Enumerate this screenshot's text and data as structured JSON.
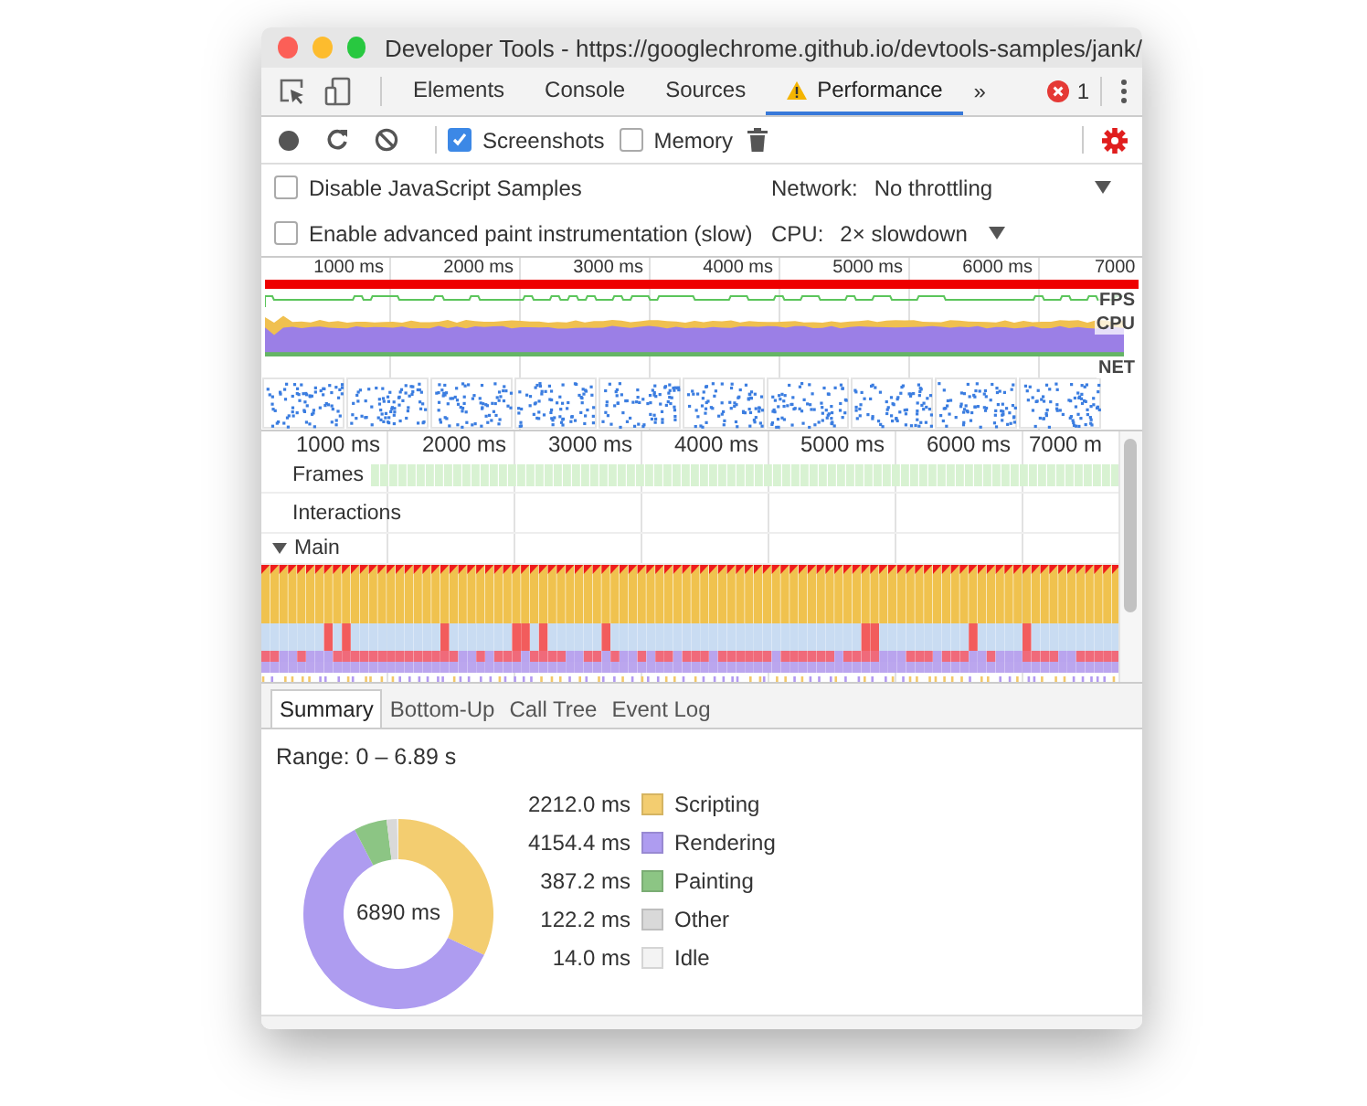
{
  "window": {
    "title": "Developer Tools - https://googlechrome.github.io/devtools-samples/jank/"
  },
  "tabs": [
    {
      "label": "Elements",
      "selected": false,
      "warning": false
    },
    {
      "label": "Console",
      "selected": false,
      "warning": false
    },
    {
      "label": "Sources",
      "selected": false,
      "warning": false
    },
    {
      "label": "Performance",
      "selected": true,
      "warning": true
    }
  ],
  "more_tabs": "»",
  "error_count": "1",
  "toolbar": {
    "options": [
      {
        "label": "Screenshots",
        "checked": true
      },
      {
        "label": "Memory",
        "checked": false
      }
    ]
  },
  "settings": {
    "options": [
      {
        "label": "Disable JavaScript Samples",
        "checked": false
      },
      {
        "label": "Enable advanced paint instrumentation (slow)",
        "checked": false
      }
    ],
    "dropdowns": [
      {
        "label": "Network:",
        "value": "No throttling"
      },
      {
        "label": "CPU:",
        "value": "2× slowdown"
      }
    ]
  },
  "overview": {
    "ticks": [
      "1000 ms",
      "2000 ms",
      "3000 ms",
      "4000 ms",
      "5000 ms",
      "6000 ms",
      "7000"
    ],
    "tracks": [
      "FPS",
      "CPU",
      "NET"
    ]
  },
  "timeline": {
    "ticks": [
      "1000 ms",
      "2000 ms",
      "3000 ms",
      "4000 ms",
      "5000 ms",
      "6000 ms",
      "7000 m"
    ],
    "tracks": [
      {
        "label": "Frames"
      },
      {
        "label": "Interactions"
      },
      {
        "label": "Main",
        "expanded": true
      }
    ]
  },
  "bottom_tabs": [
    {
      "label": "Summary",
      "selected": true
    },
    {
      "label": "Bottom-Up",
      "selected": false
    },
    {
      "label": "Call Tree",
      "selected": false
    },
    {
      "label": "Event Log",
      "selected": false
    }
  ],
  "summary": {
    "range": "Range: 0 – 6.89 s",
    "total": "6890 ms",
    "legend": [
      {
        "value": "2212.0 ms",
        "color": "#f3cd70"
      },
      {
        "value": "4154.4 ms",
        "color": "#ae9cf0"
      },
      {
        "value": "387.2 ms",
        "color": "#8cc584"
      },
      {
        "value": "122.2 ms",
        "color": "#d9d9d9"
      },
      {
        "value": "14.0 ms",
        "color": "#f3f3f3"
      }
    ],
    "chart_data": {
      "type": "donut",
      "categories": [
        "Scripting",
        "Rendering",
        "Painting",
        "Other",
        "Idle"
      ],
      "series": [
        {
          "values": [
            32.1,
            60.3,
            5.6,
            1.8,
            0.2
          ]
        }
      ]
    }
  }
}
